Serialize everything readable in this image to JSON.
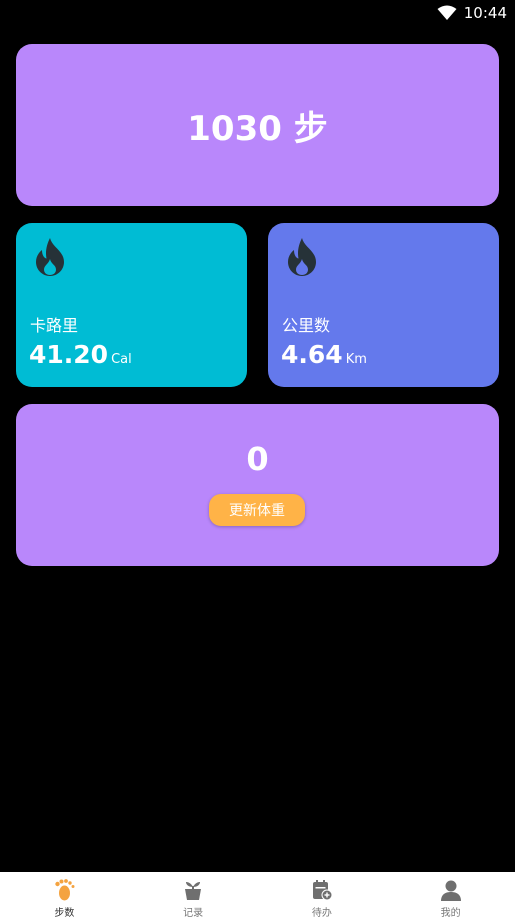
{
  "status_bar": {
    "time": "10:44"
  },
  "steps_card": {
    "text": "1030 步"
  },
  "calorie_card": {
    "label": "卡路里",
    "value": "41.20",
    "unit": "Cal"
  },
  "distance_card": {
    "label": "公里数",
    "value": "4.64",
    "unit": "Km"
  },
  "weight_card": {
    "value": "0",
    "button_label": "更新体重"
  },
  "bottom_nav": {
    "items": [
      {
        "label": "步数",
        "icon": "footprint-icon",
        "active": true
      },
      {
        "label": "记录",
        "icon": "plant-pot-icon",
        "active": false
      },
      {
        "label": "待办",
        "icon": "calendar-add-icon",
        "active": false
      },
      {
        "label": "我的",
        "icon": "person-icon",
        "active": false
      }
    ]
  },
  "colors": {
    "steps_card": "#b987fb",
    "calorie_card": "#00bcd4",
    "distance_card": "#6479ec",
    "update_button": "#ffb347",
    "active_nav_icon": "#f4a340",
    "inactive_nav_icon": "#6f6f6f"
  }
}
